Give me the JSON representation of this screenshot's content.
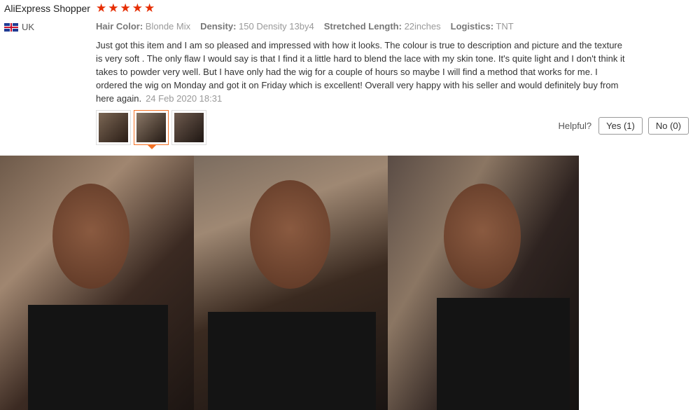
{
  "review": {
    "reviewer": "AliExpress Shopper",
    "rating": 5,
    "country": "UK",
    "attributes": [
      {
        "key": "Hair Color:",
        "value": "Blonde Mix"
      },
      {
        "key": "Density:",
        "value": "150 Density 13by4"
      },
      {
        "key": "Stretched Length:",
        "value": "22inches"
      },
      {
        "key": "Logistics:",
        "value": "TNT"
      }
    ],
    "text": "Just got this item and I am so pleased and impressed with how it looks. The colour is true to description and picture and the texture is very soft . The only flaw I would say is that I find it a little hard to blend the lace with my skin tone. It's quite light and I don't think it takes to powder very well. But I have only had the wig for a couple of hours so maybe I will find a method that works for me. I ordered the wig on Monday and got it on Friday which is excellent! Overall very happy with his seller and would definitely buy from here again.",
    "date": "24 Feb 2020 18:31",
    "helpful_label": "Helpful?",
    "yes_label": "Yes (1)",
    "no_label": "No (0)",
    "thumbnails": [
      "photo-1",
      "photo-2",
      "photo-3"
    ],
    "active_thumbnail": 2,
    "colors": {
      "star": "#e62e04",
      "active_border": "#f57224"
    }
  }
}
